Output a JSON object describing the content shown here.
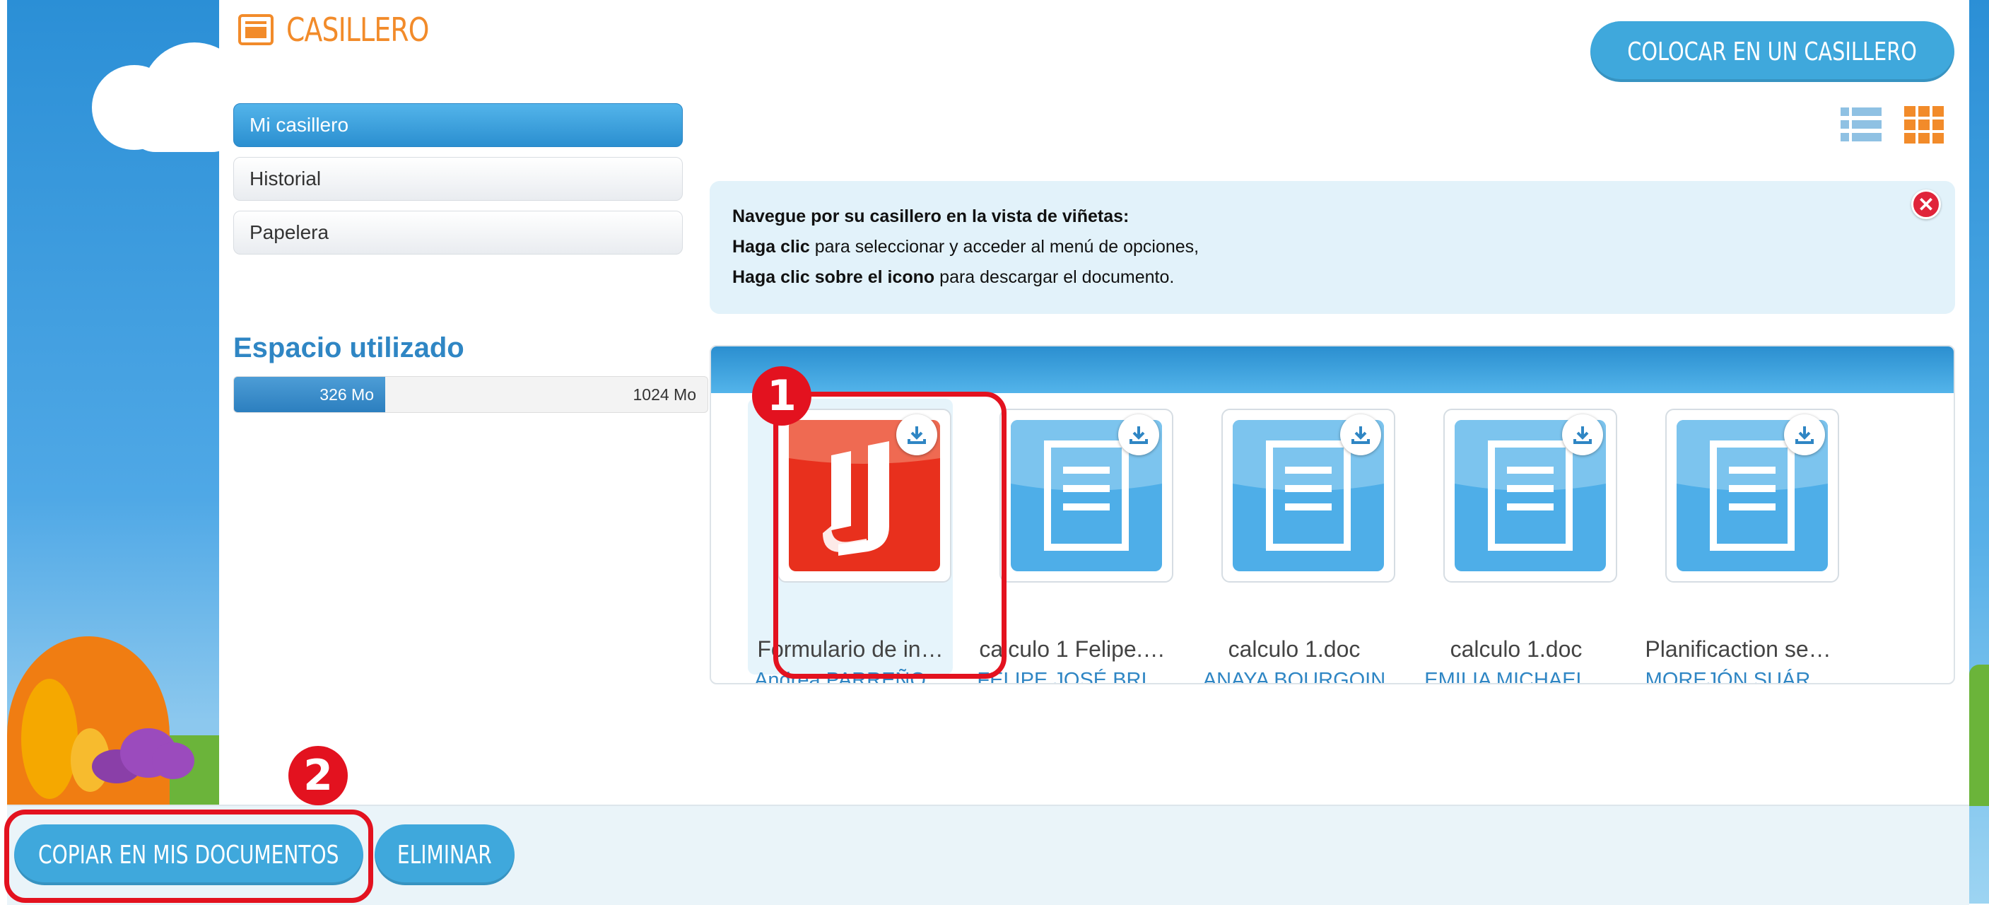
{
  "header": {
    "title": "CASILLERO",
    "place_button": "COLOCAR EN UN CASILLERO"
  },
  "sidebar": {
    "items": [
      {
        "label": "Mi casillero",
        "active": true
      },
      {
        "label": "Historial",
        "active": false
      },
      {
        "label": "Papelera",
        "active": false
      }
    ],
    "space": {
      "title": "Espacio utilizado",
      "used": "326 Mo",
      "total": "1024 Mo",
      "used_fraction": 0.32
    }
  },
  "view_toggle": {
    "list_icon": "list-view-icon",
    "grid_icon": "grid-view-icon"
  },
  "info": {
    "line1_bold": "Navegue por su casillero en la vista de viñetas:",
    "line2_bold": "Haga clic",
    "line2_rest": " para seleccionar y acceder al menú de opciones,",
    "line3_bold": "Haga clic sobre el icono",
    "line3_rest": " para descargar el documento."
  },
  "files": [
    {
      "name": "Formulario de in…",
      "owner": "Andrea PARREÑO…",
      "type": "pdf",
      "selected": true
    },
    {
      "name": "calculo 1 Felipe.…",
      "owner": "FELIPE JOSÉ BRI…",
      "type": "doc",
      "selected": false
    },
    {
      "name": "calculo 1.doc",
      "owner": "ANAYA BOURGOIN",
      "type": "doc",
      "selected": false
    },
    {
      "name": "calculo 1.doc",
      "owner": "EMILIA MICHAEL…",
      "type": "doc",
      "selected": false
    },
    {
      "name": "Planificaction se…",
      "owner": "MOREJÓN SUÁR…",
      "type": "doc",
      "selected": false
    }
  ],
  "footer": {
    "copy_button": "COPIAR EN MIS DOCUMENTOS",
    "delete_button": "ELIMINAR"
  },
  "callouts": [
    "1",
    "2"
  ],
  "colors": {
    "accent_blue": "#3fa8dc",
    "title_orange": "#f28b2a",
    "highlight_red": "#e3121f",
    "pdf_red": "#e8301d"
  }
}
